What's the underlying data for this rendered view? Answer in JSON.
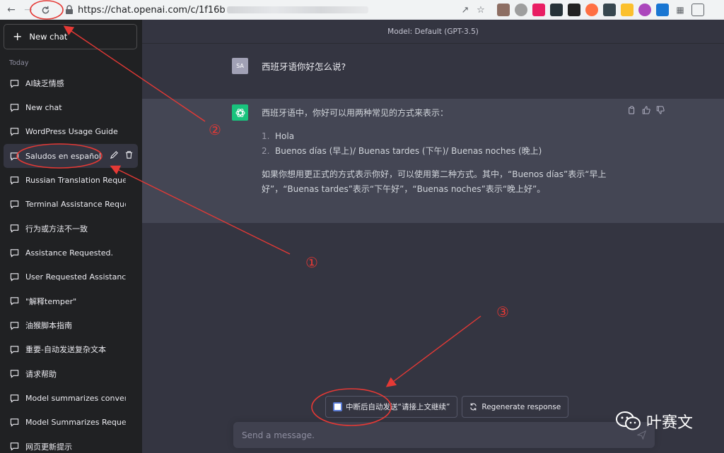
{
  "browser": {
    "url_prefix": "https://chat.openai.com/c/1f16b"
  },
  "sidebar": {
    "new_chat_label": "New chat",
    "section_today": "Today",
    "items": [
      {
        "label": "AI缺乏情感"
      },
      {
        "label": "New chat"
      },
      {
        "label": "WordPress Usage Guide"
      },
      {
        "label": "Saludos en español",
        "active": true
      },
      {
        "label": "Russian Translation Request"
      },
      {
        "label": "Terminal Assistance Request"
      },
      {
        "label": "行为或方法不一致"
      },
      {
        "label": "Assistance Requested."
      },
      {
        "label": "User Requested Assistance."
      },
      {
        "label": "\"解释temper\""
      },
      {
        "label": "油猴脚本指南"
      },
      {
        "label": "重要-自动发送复杂文本"
      },
      {
        "label": "请求帮助"
      },
      {
        "label": "Model summarizes conversation"
      },
      {
        "label": "Model Summarizes Request."
      },
      {
        "label": "网页更新提示"
      }
    ]
  },
  "main": {
    "model_label": "Model: Default (GPT-3.5)",
    "user": {
      "avatar": "SA",
      "text": "西班牙语你好怎么说?"
    },
    "assistant": {
      "intro": "西班牙语中，你好可以用两种常见的方式来表示：",
      "list": [
        {
          "num": "1.",
          "text": "Hola"
        },
        {
          "num": "2.",
          "text": "Buenos días (早上)/ Buenas tardes (下午)/ Buenas noches (晚上)"
        }
      ],
      "outro": "如果你想用更正式的方式表示你好，可以使用第二种方式。其中，“Buenos días”表示“早上好”，“Buenas tardes”表示“下午好”，“Buenas noches”表示“晚上好”。"
    },
    "auto_continue_label": "中断后自动发送“请接上文继续”",
    "regenerate_label": "Regenerate response",
    "input_placeholder": "Send a message."
  },
  "annotations": {
    "mark_1": "①",
    "mark_2": "②",
    "mark_3": "③"
  },
  "watermark": {
    "text": "叶赛文"
  },
  "colors": {
    "sidebar_bg": "#202123",
    "main_bg": "#343541",
    "assistant_bg": "#444654",
    "accent_green": "#19c37d",
    "annotation_red": "#e53935"
  }
}
